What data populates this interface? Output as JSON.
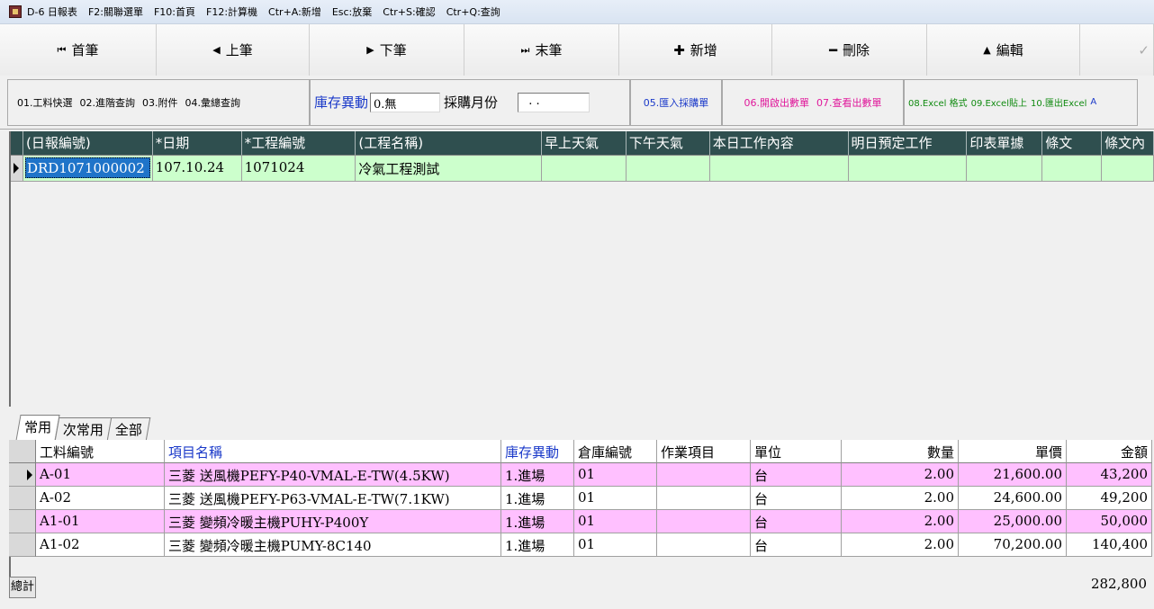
{
  "titlebar": {
    "title": "D-6 日報表",
    "shortcuts": [
      "F2:關聯選單",
      "F10:首頁",
      "F12:計算機",
      "Ctr+A:新增",
      "Esc:放棄",
      "Ctr+S:確認",
      "Ctr+Q:查詢"
    ]
  },
  "nav": {
    "first": "首筆",
    "prev": "上筆",
    "next": "下筆",
    "last": "末筆",
    "add": "新增",
    "delete": "刪除",
    "edit": "編輯"
  },
  "options": {
    "quick_materials": "01.工料快選",
    "advanced_query": "02.進階查詢",
    "attachment": "03.附件",
    "summary_query": "04.彙總查詢",
    "stock_change_label": "庫存異動",
    "stock_change_value": "0.無",
    "purchase_month_label": "採購月份",
    "purchase_month_value": "  . .",
    "import_purchase": "05.匯入採購單",
    "open_outbound": "06.開啟出數單",
    "view_outbound": "07.查看出數單",
    "excel_format": "08.Excel 格式",
    "excel_paste": "09.Excel貼上",
    "export_excel": "10.匯出Excel",
    "more": "A"
  },
  "main_grid": {
    "headers": [
      "(日報編號)",
      "*日期",
      "*工程編號",
      "(工程名稱)",
      "早上天氣",
      "下午天氣",
      "本日工作內容",
      "明日預定工作",
      "印表單據",
      "條文",
      "條文內"
    ],
    "rows": [
      [
        "DRD1071000002",
        "107.10.24",
        "1071024",
        "冷氣工程測試",
        "",
        "",
        "",
        "",
        "",
        "",
        ""
      ]
    ]
  },
  "tabs": [
    "常用",
    "次常用",
    "全部"
  ],
  "detail_grid": {
    "headers": [
      "工料編號",
      "項目名稱",
      "庫存異動",
      "倉庫編號",
      "作業項目",
      "單位",
      "數量",
      "單價",
      "金額"
    ],
    "rows": [
      [
        "A-01",
        "三菱 送風機PEFY-P40-VMAL-E-TW(4.5KW)",
        "1.進場",
        "01",
        "",
        "台",
        "2.00",
        "21,600.00",
        "43,200"
      ],
      [
        "A-02",
        "三菱 送風機PEFY-P63-VMAL-E-TW(7.1KW)",
        "1.進場",
        "01",
        "",
        "台",
        "2.00",
        "24,600.00",
        "49,200"
      ],
      [
        "A1-01",
        "三菱 變頻冷暖主機PUHY-P400Y",
        "1.進場",
        "01",
        "",
        "台",
        "2.00",
        "25,000.00",
        "50,000"
      ],
      [
        "A1-02",
        "三菱 變頻冷暖主機PUMY-8C140",
        "1.進場",
        "01",
        "",
        "台",
        "2.00",
        "70,200.00",
        "140,400"
      ]
    ],
    "total_label": "總計",
    "total_value": "282,800"
  }
}
